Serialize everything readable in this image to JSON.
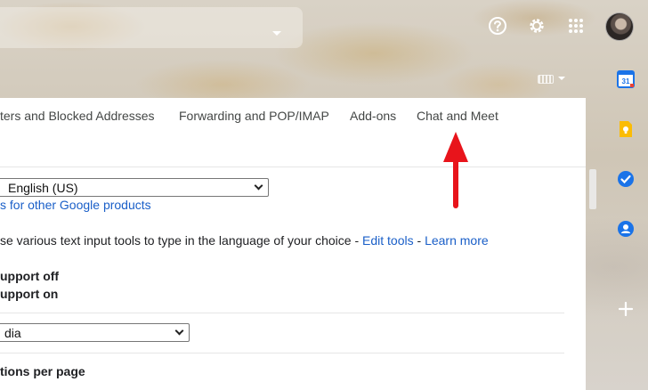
{
  "topbar": {
    "help_icon": "help-circle-icon",
    "settings_icon": "gear-icon",
    "apps_icon": "apps-grid-icon"
  },
  "tabs": [
    {
      "label": "ters and Blocked Addresses"
    },
    {
      "label": "Forwarding and POP/IMAP"
    },
    {
      "label": "Add-ons"
    },
    {
      "label": "Chat and Meet"
    }
  ],
  "language": {
    "selected": "English (US)",
    "other_products_link": "s for other Google products",
    "input_tools_text": "se various text input tools to type in the language of your choice - ",
    "edit_tools_link": "Edit tools",
    "separator": " - ",
    "learn_more_link": "Learn more"
  },
  "rtl": {
    "off_label": "upport off",
    "on_label": "upport on"
  },
  "country": {
    "selected": "dia"
  },
  "page_size": {
    "label": "tions per page"
  },
  "side_rail": {
    "calendar_badge": "31"
  },
  "colors": {
    "link": "#1a5fc8",
    "arrow": "#e8141b"
  }
}
